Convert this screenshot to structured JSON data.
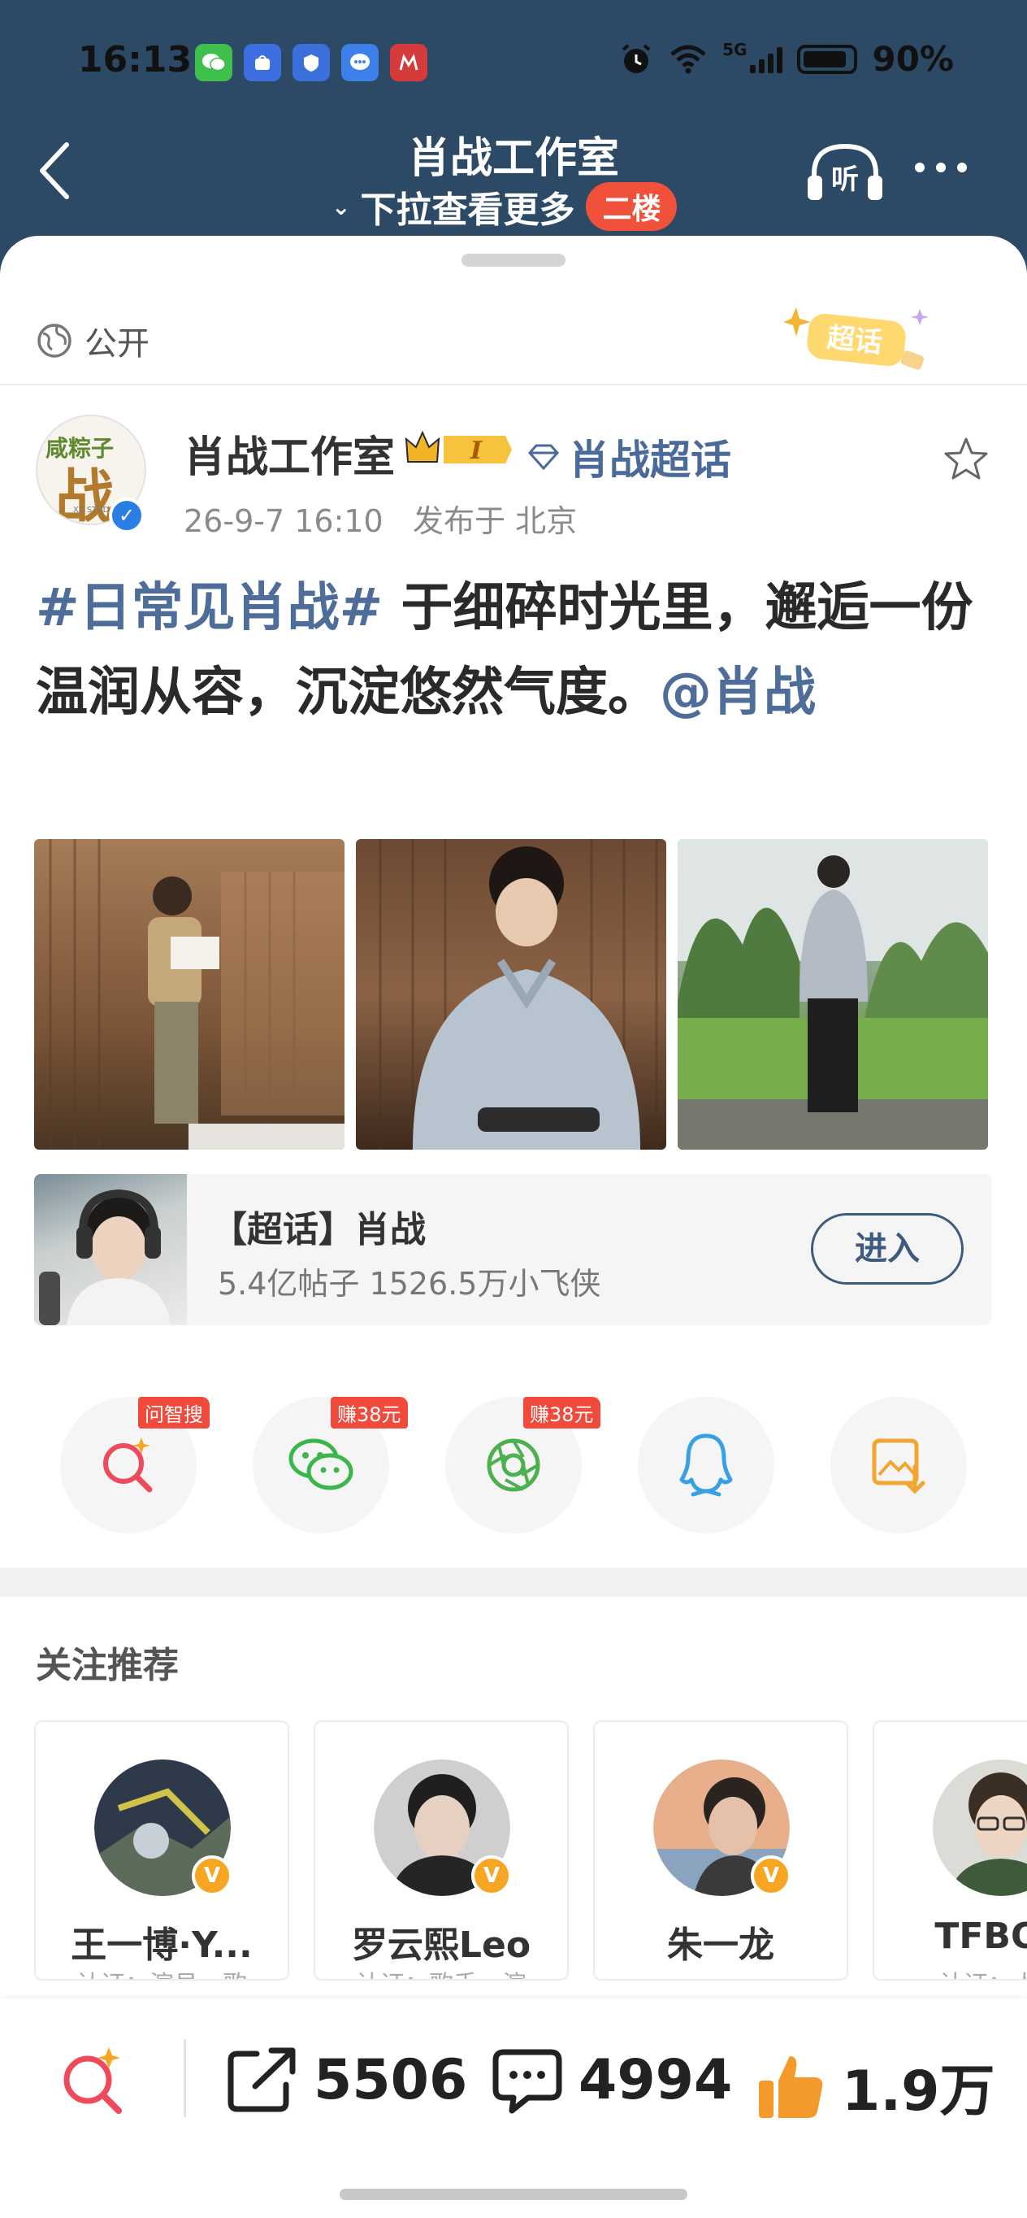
{
  "status_bar": {
    "time": "16:13",
    "network": "5G",
    "battery": "90%",
    "battery_level": 0.9
  },
  "header": {
    "title": "肖战工作室",
    "subtitle": "下拉查看更多",
    "badge": "二楼",
    "listen_label": "听"
  },
  "post": {
    "visibility": "公开",
    "chaohua_badge": "超话",
    "author": "肖战工作室",
    "author_level": "I",
    "topic_link": "肖战超话",
    "timestamp": "26-9-7 16:10",
    "location": "发布于 北京",
    "avatar_top_text": "咸粽子",
    "avatar_char": "战",
    "avatar_studio": "XZ STUDIO",
    "hashtag": "#日常见肖战#",
    "text_part1": " 于细碎时光里，邂逅一份温润从容，沉淀悠然气度。",
    "mention": "@肖战"
  },
  "super_topic": {
    "name": "【超话】肖战",
    "stats": "5.4亿帖子 1526.5万小飞侠",
    "enter_label": "进入"
  },
  "share_tags": {
    "search": "问智搜",
    "wechat": "赚38元",
    "moments": "赚38元"
  },
  "recommend": {
    "title": "关注推荐",
    "items": [
      {
        "name": "王一博·Y...",
        "desc": "认证：演员、歌"
      },
      {
        "name": "罗云熙Leo",
        "desc": "认证：歌手、演"
      },
      {
        "name": "朱一龙",
        "desc": ""
      },
      {
        "name": "TFBOY",
        "desc": "认证：人气"
      }
    ]
  },
  "bottom_bar": {
    "shares": "5506",
    "comments": "4994",
    "likes": "1.9万"
  },
  "colors": {
    "header_bg": "#2c4a66",
    "link": "#4e6d99",
    "accent_red": "#ef4a3c",
    "like_orange": "#f39a2b"
  }
}
